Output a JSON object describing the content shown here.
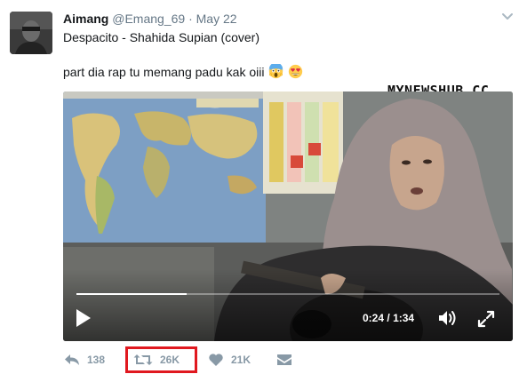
{
  "tweet": {
    "display_name": "Aimang",
    "handle": "@Emang_69",
    "separator": "·",
    "date": "May 22",
    "line1": "Despacito - Shahida Supian (cover)",
    "line2": "part dia rap tu memang padu kak oiii",
    "emojis": [
      "face-screaming-in-fear-icon",
      "heart-eyes-icon"
    ]
  },
  "watermark": "MYNEWSHUB.CC",
  "video": {
    "current_time": "0:24",
    "time_separator": "/",
    "duration": "1:34",
    "progress_fraction": 0.26
  },
  "actions": {
    "reply_count": "138",
    "retweet_count": "26K",
    "like_count": "21K"
  },
  "colors": {
    "text": "#14171a",
    "secondary": "#657786",
    "action_gray": "#8899a6",
    "highlight_red": "#e0181f"
  }
}
